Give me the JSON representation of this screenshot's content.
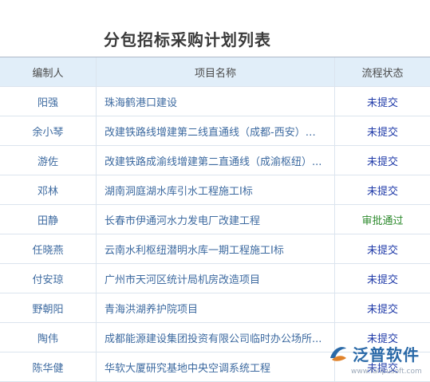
{
  "title": "分包招标采购计划列表",
  "columns": [
    "编制人",
    "项目名称",
    "流程状态"
  ],
  "rows": [
    {
      "owner": "阳强",
      "project": "珠海鹤港口建设",
      "status": "未提交",
      "status_color": "#1f3aa8"
    },
    {
      "owner": "余小琴",
      "project": "改建铁路线增建第二线直通线（成都-西安）电...",
      "status": "未提交",
      "status_color": "#1f3aa8"
    },
    {
      "owner": "游佐",
      "project": "改建铁路成渝线增建第二直通线（成渝枢纽）...",
      "status": "未提交",
      "status_color": "#1f3aa8"
    },
    {
      "owner": "邓林",
      "project": "湖南洞庭湖水库引水工程施工I标",
      "status": "未提交",
      "status_color": "#1f3aa8"
    },
    {
      "owner": "田静",
      "project": "长春市伊通河水力发电厂改建工程",
      "status": "审批通过",
      "status_color": "#2d8a2d"
    },
    {
      "owner": "任晓燕",
      "project": "云南水利枢纽潜明水库一期工程施工I标",
      "status": "未提交",
      "status_color": "#1f3aa8"
    },
    {
      "owner": "付安琼",
      "project": "广州市天河区统计局机房改造项目",
      "status": "未提交",
      "status_color": "#1f3aa8"
    },
    {
      "owner": "野朝阳",
      "project": "青海洪湖养护院项目",
      "status": "未提交",
      "status_color": "#1f3aa8"
    },
    {
      "owner": "陶伟",
      "project": "成都能源建设集团投资有限公司临时办公场所...",
      "status": "未提交",
      "status_color": "#1f3aa8"
    },
    {
      "owner": "陈华健",
      "project": "华软大厦研究基地中央空调系统工程",
      "status": "未提交",
      "status_color": "#1f3aa8"
    }
  ],
  "logo": {
    "text": "泛普软件",
    "url": "www.fanpusoft.com",
    "color": "#2b6aa8",
    "icon": "fanpu-logo-icon"
  }
}
